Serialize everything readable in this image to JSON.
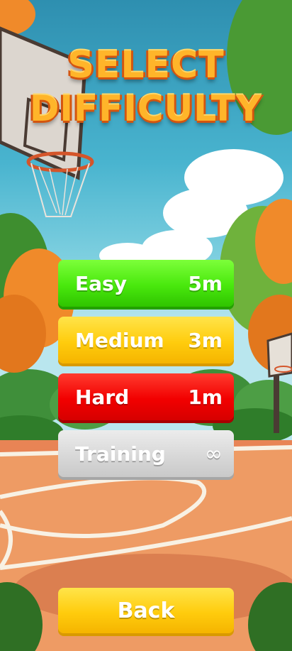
{
  "title": {
    "line1": "SELECT",
    "line2": "DIFFICULTY"
  },
  "difficulties": [
    {
      "label": "Easy",
      "time": "5m",
      "color": "#49e80d"
    },
    {
      "label": "Medium",
      "time": "3m",
      "color": "#ffcc0d"
    },
    {
      "label": "Hard",
      "time": "1m",
      "color": "#f20000"
    },
    {
      "label": "Training",
      "time": "∞",
      "color": "#d8d8d8"
    }
  ],
  "back_label": "Back"
}
